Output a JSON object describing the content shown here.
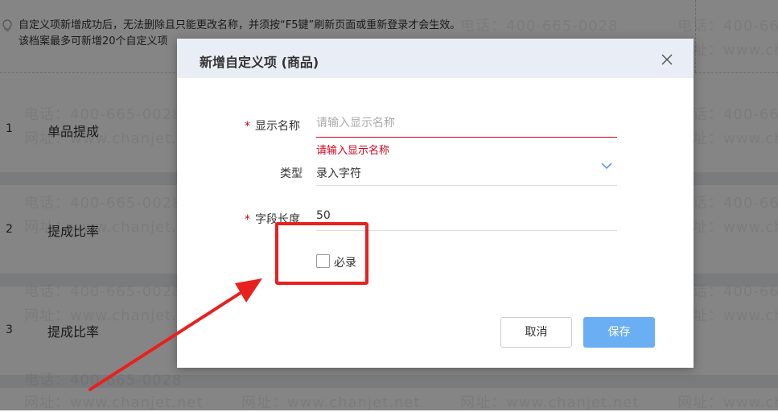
{
  "notice": {
    "line1": "自定义项新增成功后，无法删除且只能更改名称，并须按“F5键”刷新页面或重新登录才会生效。",
    "line2": "该档案最多可新增20个自定义项"
  },
  "rows": [
    {
      "num": "1",
      "text": "单品提成"
    },
    {
      "num": "2",
      "text": "提成比率"
    },
    {
      "num": "3",
      "text": "提成比率"
    }
  ],
  "watermark": {
    "phone": "电话：400-665-0028",
    "site": "网址：www.chanjet.net"
  },
  "modal": {
    "title": "新增自定义项 (商品)",
    "display_name": {
      "required_mark": "*",
      "label": "显示名称",
      "placeholder": "请输入显示名称",
      "error": "请输入显示名称"
    },
    "type": {
      "label": "类型",
      "value": "录入字符"
    },
    "field_length": {
      "required_mark": "*",
      "label": "字段长度",
      "value": "50"
    },
    "required_checkbox": {
      "label": "必录",
      "checked": false
    },
    "buttons": {
      "cancel": "取消",
      "save": "保存"
    }
  },
  "colors": {
    "error": "#d0021b",
    "primary": "#6aaef3",
    "annotation": "#e8201e",
    "header_bg": "#e9eef6"
  }
}
